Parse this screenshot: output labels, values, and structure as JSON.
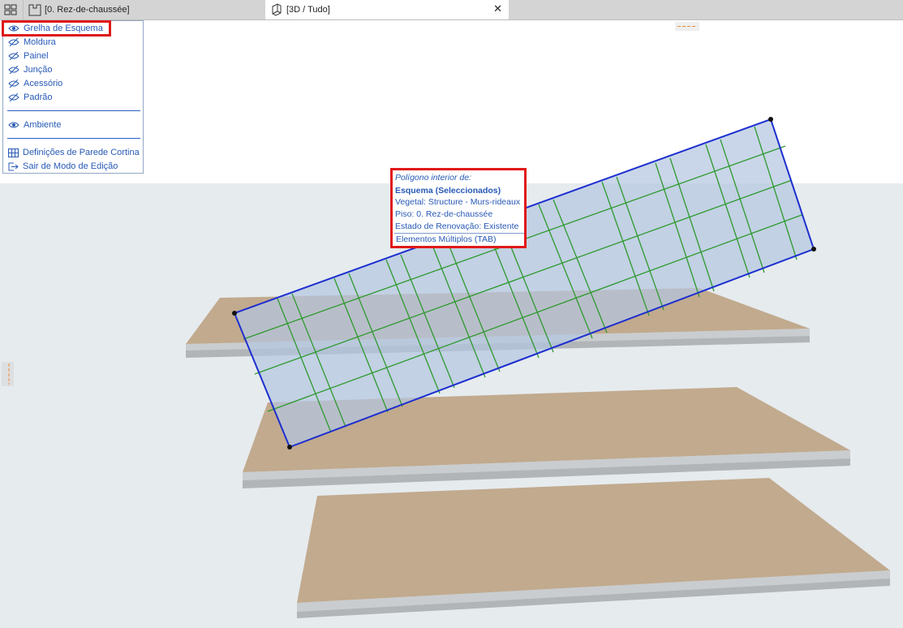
{
  "tabs": {
    "tab1_label": "[0. Rez-de-chaussée]",
    "tab2_label": "[3D / Tudo]",
    "close_glyph": "✕"
  },
  "menu": {
    "items": [
      {
        "label": "Grelha de Esquema",
        "icon": "eye-visible-icon",
        "state": "visible",
        "highlighted": true
      },
      {
        "label": "Moldura",
        "icon": "eye-hidden-icon",
        "state": "hidden"
      },
      {
        "label": "Painel",
        "icon": "eye-hidden-icon",
        "state": "hidden"
      },
      {
        "label": "Junção",
        "icon": "eye-hidden-icon",
        "state": "hidden"
      },
      {
        "label": "Acessório",
        "icon": "eye-hidden-icon",
        "state": "hidden"
      },
      {
        "label": "Padrão",
        "icon": "eye-hidden-icon",
        "state": "hidden"
      },
      {
        "label": "Ambiente",
        "icon": "eye-visible-icon",
        "state": "visible"
      },
      {
        "label": "Definições de Parede Cortina",
        "icon": "curtain-wall-settings-icon"
      },
      {
        "label": "Sair de Modo de Edição",
        "icon": "exit-edit-mode-icon"
      }
    ]
  },
  "tooltip": {
    "line1": "Polígono interior de:",
    "line2": "Esquema (Seleccionados)",
    "line3": "Vegetal: Structure - Murs-rideaux",
    "line4": "Piso: 0. Rez-de-chaussée",
    "line5": "Estado de Renovação: Existente",
    "line6": "Elementos Múltiplos (TAB)"
  },
  "colors": {
    "accent_text": "#2759b5",
    "highlight_red": "#e01919",
    "slab_top": "#c1aa8e",
    "grid_green": "#2e9a2e",
    "selection_blue": "#1d2fd0",
    "panel_fill": "#b7c8e2"
  }
}
